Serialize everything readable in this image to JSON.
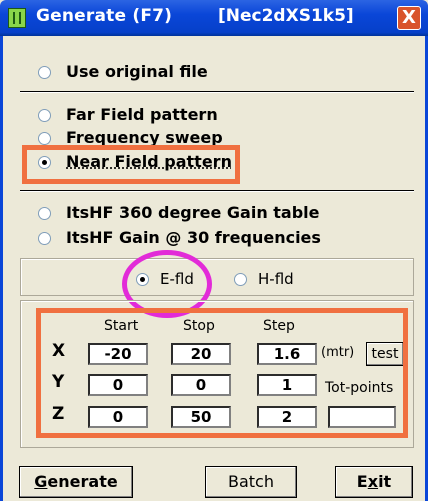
{
  "window": {
    "title": "Generate (F7)",
    "title_extra": "[Nec2dXS1k5]",
    "close_glyph": "X"
  },
  "options": {
    "use_original": "Use original file",
    "far_field": "Far Field pattern",
    "freq_sweep": "Frequency sweep",
    "near_field": "Near Field pattern",
    "itshf_360": "ItsHF 360 degree Gain table",
    "itshf_30": "ItsHF Gain @ 30 frequencies",
    "selected": "near_field"
  },
  "field_type": {
    "e_fld": "E-fld",
    "h_fld": "H-fld",
    "selected": "e_fld"
  },
  "grid": {
    "headers": {
      "start": "Start",
      "stop": "Stop",
      "step": "Step"
    },
    "rows": [
      {
        "axis": "X",
        "start": "-20",
        "stop": "20",
        "step": "1.6"
      },
      {
        "axis": "Y",
        "start": "0",
        "stop": "0",
        "step": "1"
      },
      {
        "axis": "Z",
        "start": "0",
        "stop": "50",
        "step": "2"
      }
    ],
    "unit": "(mtr)",
    "test_label": "test",
    "tot_points_label": "Tot-points",
    "tot_points_value": ""
  },
  "buttons": {
    "generate_first": "G",
    "generate_rest": "enerate",
    "batch": "Batch",
    "exit_pre": "E",
    "exit_ul": "x",
    "exit_post": "it"
  },
  "colors": {
    "highlight_box": "#f07040",
    "highlight_circle": "#e22bd8",
    "titlebar": "#0a46d8"
  }
}
